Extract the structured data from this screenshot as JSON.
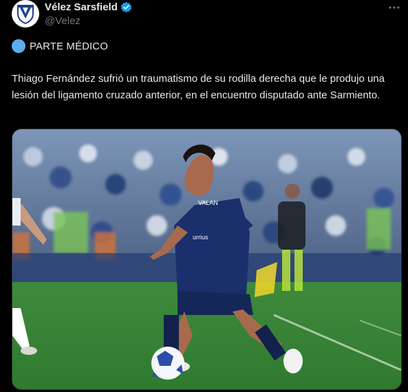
{
  "account": {
    "display_name": "Vélez Sarsfield",
    "handle": "@Velez",
    "verified": true,
    "avatar_icon": "velez-crest-icon"
  },
  "post": {
    "label": "PARTE MÉDICO",
    "label_emoji": "blue-circle-icon",
    "text": "Thiago Fernández sufrió un traumatismo de su rodilla derecha que le produjo una lesión del ligamento cruzado anterior, en el encuentro disputado ante Sarmiento."
  },
  "media": {
    "type": "photo",
    "kit_text": [
      "VALAN",
      "urrius"
    ]
  },
  "colors": {
    "background": "#000000",
    "text_primary": "#e7e9ea",
    "text_secondary": "#71767b",
    "verified_blue": "#1d9bf0",
    "emoji_blue": "#5dadec"
  }
}
